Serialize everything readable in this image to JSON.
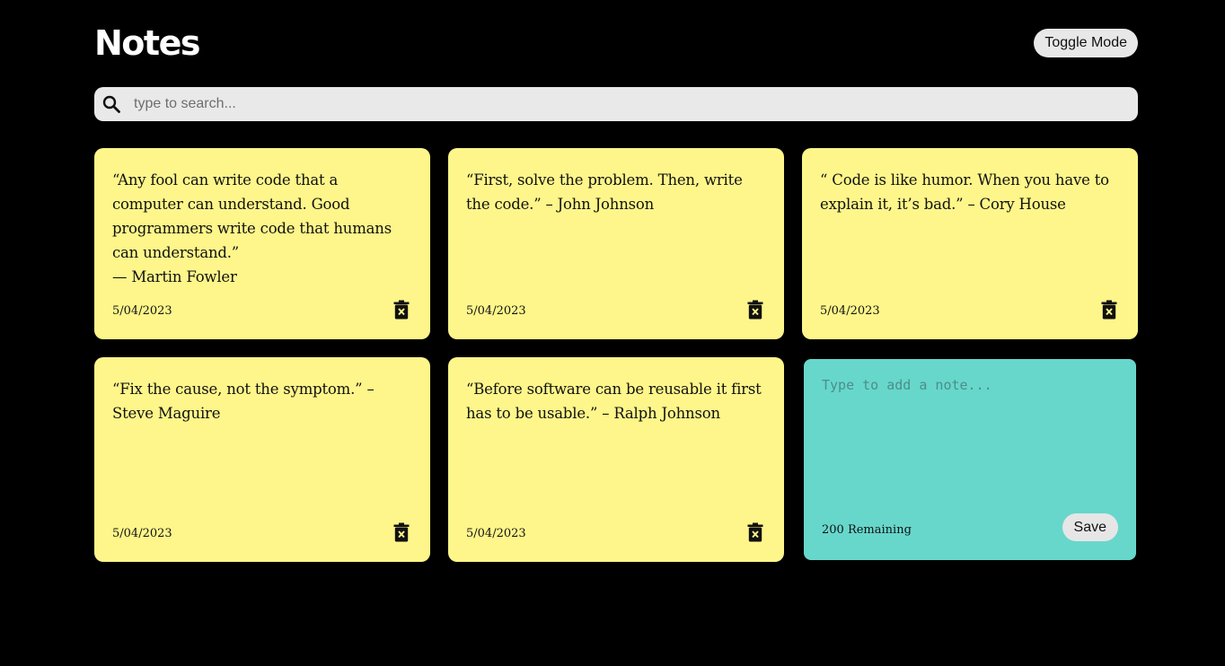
{
  "header": {
    "title": "Notes",
    "toggle_label": "Toggle Mode"
  },
  "search": {
    "placeholder": "type to search...",
    "value": "",
    "icon": "search-icon"
  },
  "notes": [
    {
      "text": "“Any fool can write code that a computer can understand. Good programmers write code that humans can understand.”\n— Martin Fowler",
      "date": "5/04/2023"
    },
    {
      "text": "“First, solve the problem. Then, write the code.” – John Johnson",
      "date": "5/04/2023"
    },
    {
      "text": "“ Code is like humor. When you have to explain it, it’s bad.” – Cory House",
      "date": "5/04/2023"
    },
    {
      "text": "“Fix the cause, not the symptom.” – Steve Maguire",
      "date": "5/04/2023"
    },
    {
      "text": "“Before software can be reusable it first has to be usable.” – Ralph Johnson",
      "date": "5/04/2023"
    }
  ],
  "new_note": {
    "placeholder": "Type to add a note...",
    "value": "",
    "remaining_label": "200 Remaining",
    "save_label": "Save"
  },
  "colors": {
    "background": "#000000",
    "note": "#fef68a",
    "new_note": "#67d7cc",
    "search_bg": "#e9e9e9",
    "button_bg": "#e8e8e8"
  }
}
